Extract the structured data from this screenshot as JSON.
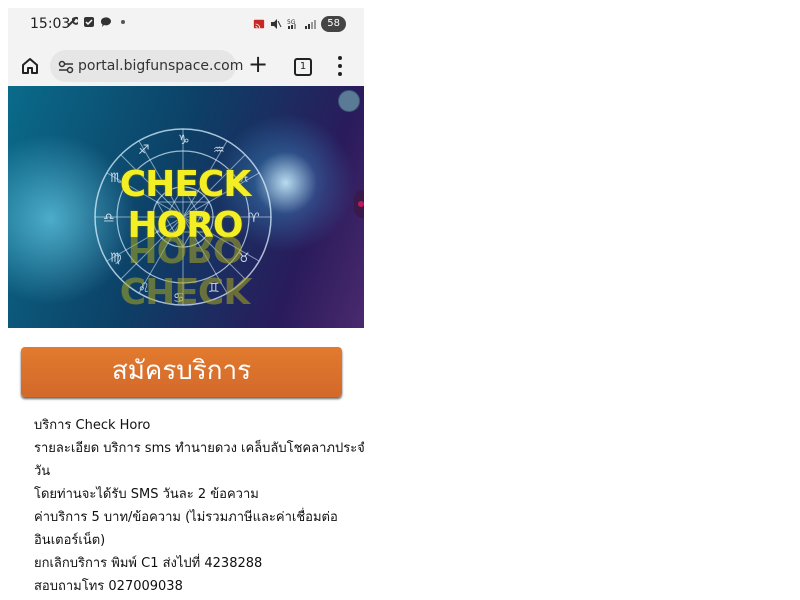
{
  "status_bar": {
    "time": "15:03",
    "battery": "58",
    "icons_left": [
      "wrench-icon",
      "checkbox-icon",
      "chat-bubble-icon",
      "dot-icon"
    ],
    "icons_right": [
      "cast-icon",
      "mute-icon",
      "signal-5g-icon",
      "signal-bars-icon"
    ]
  },
  "browser": {
    "url": "portal.bigfunspace.com",
    "tab_count": "1"
  },
  "banner": {
    "title": "CHECK HORO"
  },
  "subscribe_label": "สมัครบริการ",
  "info_lines": [
    "บริการ Check Horo",
    "รายละเอียด บริการ sms ทำนายดวง เคล็บลับโชคลาภประจำ",
    "วัน",
    "โดยท่านจะได้รับ SMS วันละ 2 ข้อความ",
    "ค่าบริการ 5 บาท/ข้อความ (ไม่รวมภาษีและค่าเชื่อมต่อ",
    "อินเตอร์เน็ต)",
    "ยกเลิกบริการ พิมพ์ C1 ส่งไปที่ 4238288",
    "สอบถามโทร 027009038"
  ]
}
